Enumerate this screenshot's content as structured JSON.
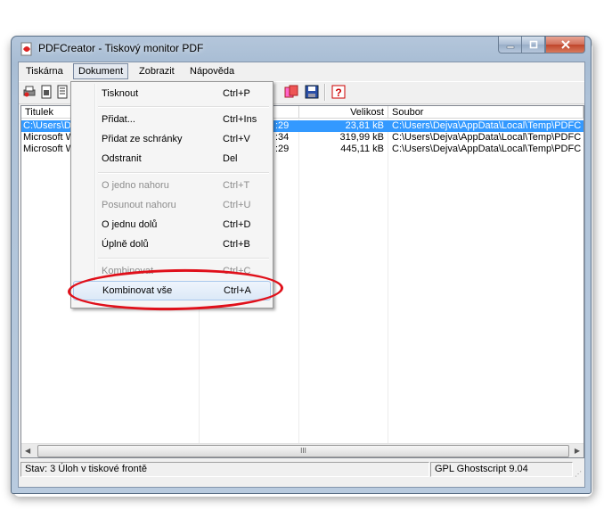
{
  "window": {
    "title": "PDFCreator - Tiskový monitor PDF"
  },
  "menubar": {
    "items": [
      "Tiskárna",
      "Dokument",
      "Zobrazit",
      "Nápověda"
    ]
  },
  "list": {
    "columns": [
      "Titulek",
      "Velikost",
      "Soubor"
    ],
    "rows": [
      {
        "title": "C:\\Users\\D",
        "time": ":29",
        "size": "23,81 kB",
        "file": "C:\\Users\\Dejva\\AppData\\Local\\Temp\\PDFC"
      },
      {
        "title": "Microsoft W",
        "time": ":34",
        "size": "319,99 kB",
        "file": "C:\\Users\\Dejva\\AppData\\Local\\Temp\\PDFC"
      },
      {
        "title": "Microsoft W",
        "time": ":29",
        "size": "445,11 kB",
        "file": "C:\\Users\\Dejva\\AppData\\Local\\Temp\\PDFC"
      }
    ],
    "scroll_thumb": "III"
  },
  "status": {
    "left": "Stav: 3 Úloh v tiskové frontě",
    "right": "GPL Ghostscript 9.04"
  },
  "dropdown": {
    "items": [
      {
        "label": "Tisknout",
        "shortcut": "Ctrl+P"
      },
      {
        "label": "Přidat...",
        "shortcut": "Ctrl+Ins"
      },
      {
        "label": "Přidat ze schránky",
        "shortcut": "Ctrl+V"
      },
      {
        "label": "Odstranit",
        "shortcut": "Del"
      },
      {
        "label": "O jedno nahoru",
        "shortcut": "Ctrl+T"
      },
      {
        "label": "Posunout nahoru",
        "shortcut": "Ctrl+U"
      },
      {
        "label": "O jednu dolů",
        "shortcut": "Ctrl+D"
      },
      {
        "label": "Úplně dolů",
        "shortcut": "Ctrl+B"
      },
      {
        "label": "Kombinovat",
        "shortcut": "Ctrl+C"
      },
      {
        "label": "Kombinovat vše",
        "shortcut": "Ctrl+A"
      }
    ]
  },
  "colors": {
    "selection": "#3399ff",
    "highlight_ellipse": "#e0101a",
    "disabled_text": "#8d8d8d"
  }
}
